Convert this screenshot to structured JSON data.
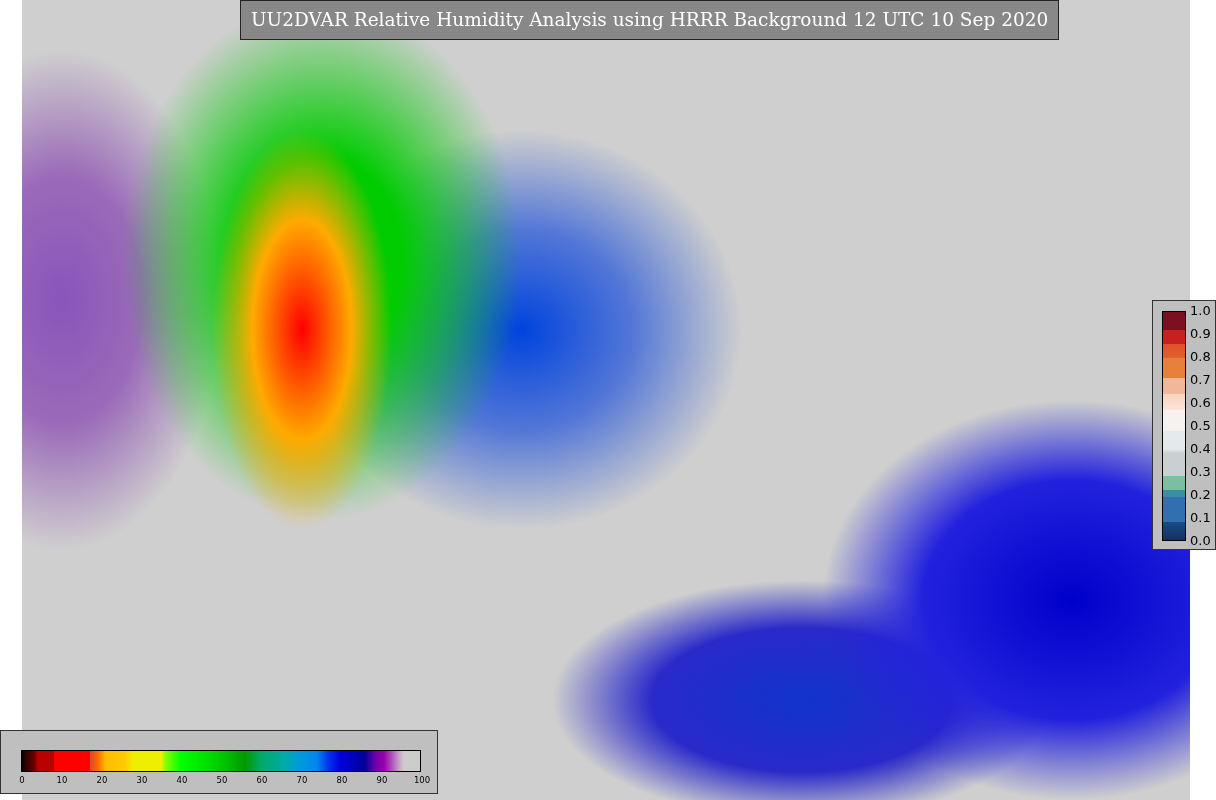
{
  "title": "UU2DVAR Relative Humidity Analysis using HRRR Background 12 UTC 10 Sep 2020",
  "colorbars": [
    {
      "kind": "horizontal",
      "ticks": [
        "0",
        "10",
        "20",
        "30",
        "40",
        "50",
        "60",
        "70",
        "80",
        "90",
        "100"
      ]
    },
    {
      "kind": "vertical",
      "ticks": [
        "1.0",
        "0.9",
        "0.8",
        "0.7",
        "0.6",
        "0.5",
        "0.4",
        "0.3",
        "0.2",
        "0.1",
        "0.0"
      ]
    }
  ]
}
